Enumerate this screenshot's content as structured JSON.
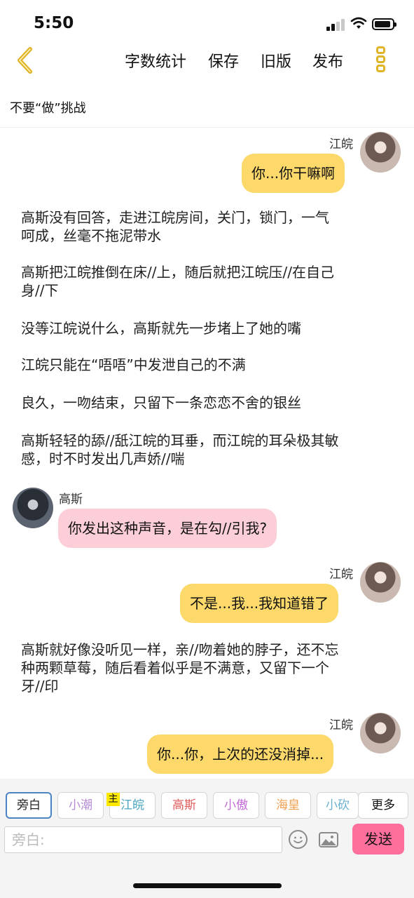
{
  "status_bar": {
    "time": "5:50"
  },
  "nav": {
    "back_icon": "chevron-left-icon",
    "items": [
      "字数统计",
      "保存",
      "旧版",
      "发布"
    ],
    "more_icon": "more-vertical-icon",
    "accent": "#e0b428"
  },
  "doc_title": "不要“做”挑战",
  "chat": [
    {
      "type": "dialog",
      "side": "right",
      "speaker": "江皖",
      "text": "你...你干嘛啊",
      "bubble_color": "#fcd96a"
    },
    {
      "type": "narration",
      "lines": [
        "高斯没有回答，走进江皖房间，关门，锁门，一气",
        "呵成，丝毫不拖泥带水"
      ]
    },
    {
      "type": "narration",
      "lines": [
        "高斯把江皖推倒在床//上，随后就把江皖压//在自己",
        "身//下"
      ]
    },
    {
      "type": "narration",
      "lines": [
        "没等江皖说什么，高斯就先一步堵上了她的嘴"
      ]
    },
    {
      "type": "narration",
      "lines": [
        "江皖只能在“唔唔”中发泄自己的不满"
      ]
    },
    {
      "type": "narration",
      "lines": [
        "良久，一吻结束，只留下一条恋恋不舍的银丝"
      ]
    },
    {
      "type": "narration",
      "lines": [
        "高斯轻轻的舔//舐江皖的耳垂，而江皖的耳朵极其敏",
        "感，时不时发出几声娇//喘"
      ]
    },
    {
      "type": "dialog",
      "side": "left",
      "speaker": "高斯",
      "text": "你发出这种声音，是在勾//引我?",
      "bubble_color": "#fccfd8"
    },
    {
      "type": "dialog",
      "side": "right",
      "speaker": "江皖",
      "text": "不是...我...我知道错了",
      "bubble_color": "#fcd96a"
    },
    {
      "type": "narration",
      "lines": [
        "高斯就好像没听见一样，亲//吻着她的脖子，还不忘",
        "种两颗草莓，随后看着似乎是不满意，又留下一个",
        "牙//印"
      ]
    },
    {
      "type": "dialog",
      "side": "right",
      "speaker": "江皖",
      "text": "你...你，上次的还没消掉...",
      "bubble_color": "#fcd96a"
    }
  ],
  "characters": [
    {
      "label": "旁白",
      "color": "#222222",
      "selected": true
    },
    {
      "label": "小潮",
      "color": "#b48ad6",
      "selected": false
    },
    {
      "label": "江皖",
      "color": "#4aa6c0",
      "selected": false,
      "badge": "主"
    },
    {
      "label": "高斯",
      "color": "#e05a5a",
      "selected": false
    },
    {
      "label": "小傲",
      "color": "#c46ad8",
      "selected": false
    },
    {
      "label": "海皇",
      "color": "#f0a050",
      "selected": false
    },
    {
      "label": "小砍",
      "color": "#6ab0d0",
      "selected": false
    }
  ],
  "more_label": "更多",
  "composer": {
    "placeholder": "旁白:",
    "emoji_icon": "emoji-icon",
    "image_icon": "image-icon",
    "send_label": "发送",
    "send_color": "#ff6f9c"
  }
}
